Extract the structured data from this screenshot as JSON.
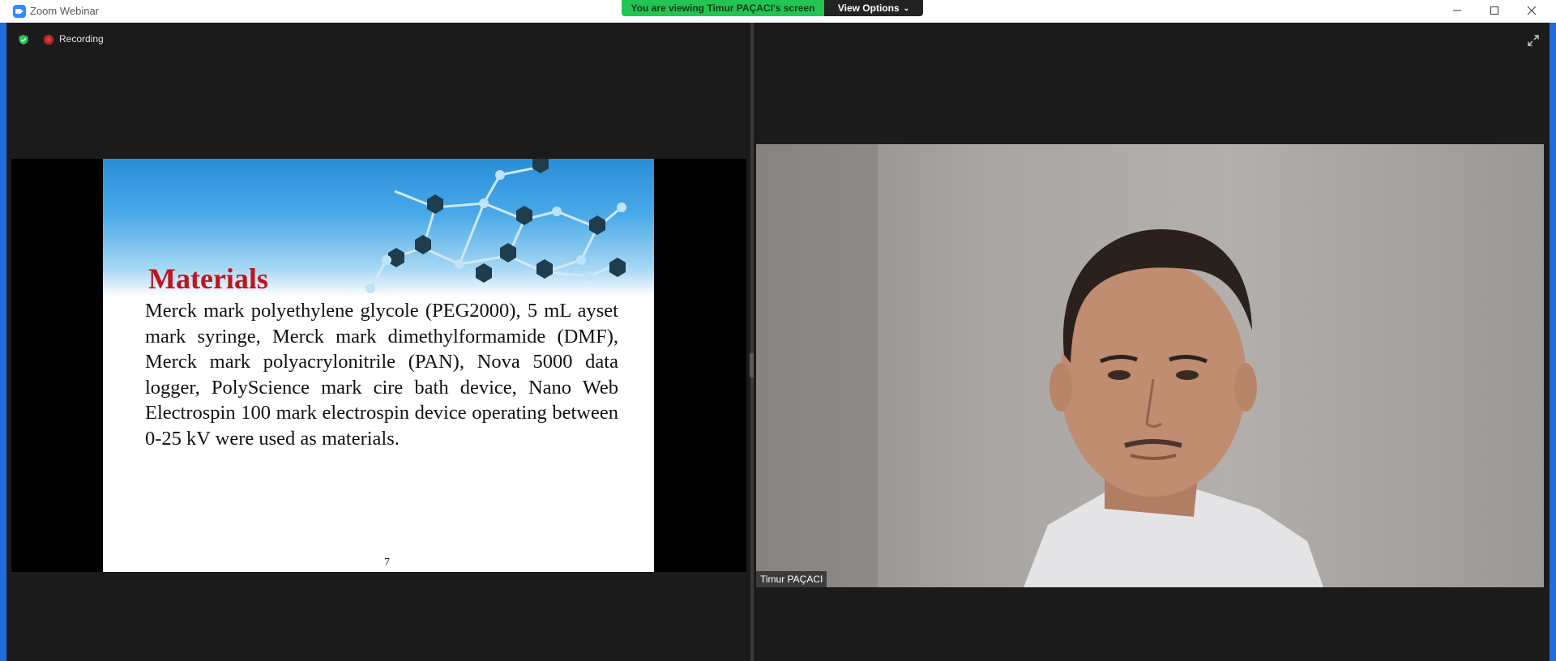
{
  "window": {
    "title": "Zoom Webinar",
    "viewing_banner": "You are viewing Timur PAÇACI's screen",
    "view_options": "View Options"
  },
  "status": {
    "recording_label": "Recording"
  },
  "slide": {
    "title": "Materials",
    "body": "Merck mark polyethylene glycole (PEG2000), 5 mL ayset mark syringe, Merck mark dimethylformamide (DMF), Merck mark polyacrylonitrile (PAN), Nova 5000 data logger, PolyScience mark cire bath device, Nano Web Electrospin 100 mark electrospin device operating between 0-25 kV were used as materials.",
    "page_number": "7"
  },
  "participant": {
    "name": "Timur PAÇACI"
  },
  "colors": {
    "accent_blue": "#1f6cdc",
    "banner_green": "#23c552",
    "slide_title_red": "#c0141b"
  }
}
